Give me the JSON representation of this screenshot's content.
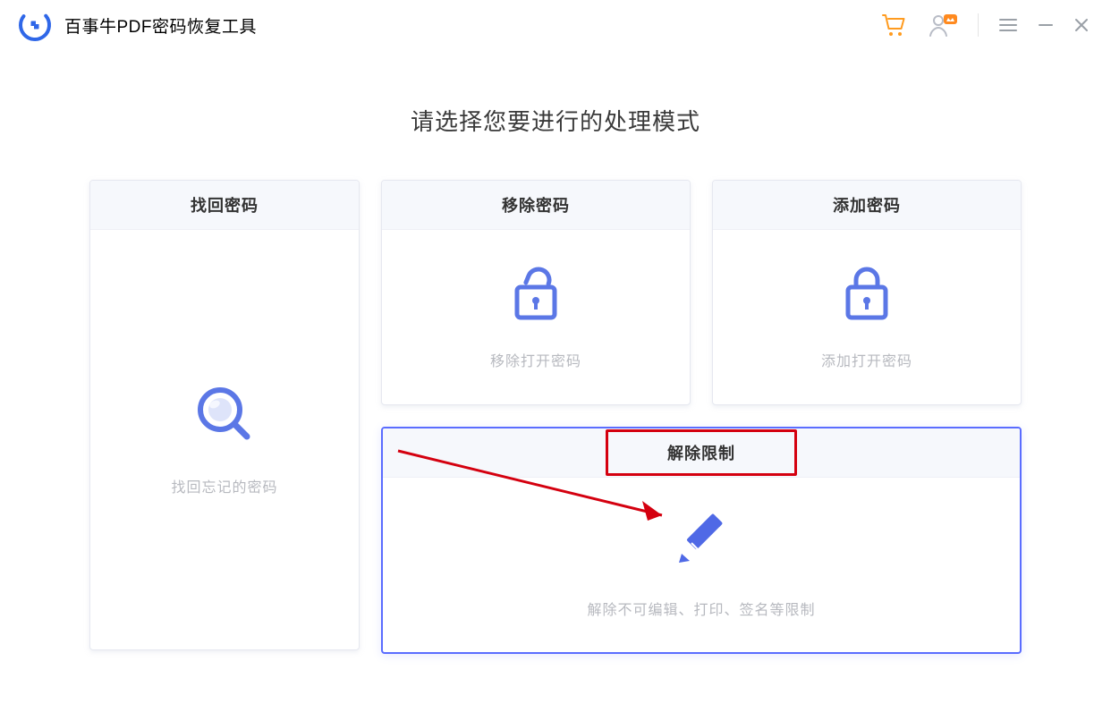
{
  "app": {
    "title": "百事牛PDF密码恢复工具"
  },
  "main": {
    "heading": "请选择您要进行的处理模式"
  },
  "cards": {
    "find": {
      "title": "找回密码",
      "desc": "找回忘记的密码"
    },
    "remove": {
      "title": "移除密码",
      "desc": "移除打开密码"
    },
    "add": {
      "title": "添加密码",
      "desc": "添加打开密码"
    },
    "restrict": {
      "title": "解除限制",
      "desc": "解除不可编辑、打印、签名等限制"
    }
  },
  "colors": {
    "accent": "#5b77e6",
    "cart_icon": "#ff9b1f",
    "window_control": "#9aa0a7"
  }
}
